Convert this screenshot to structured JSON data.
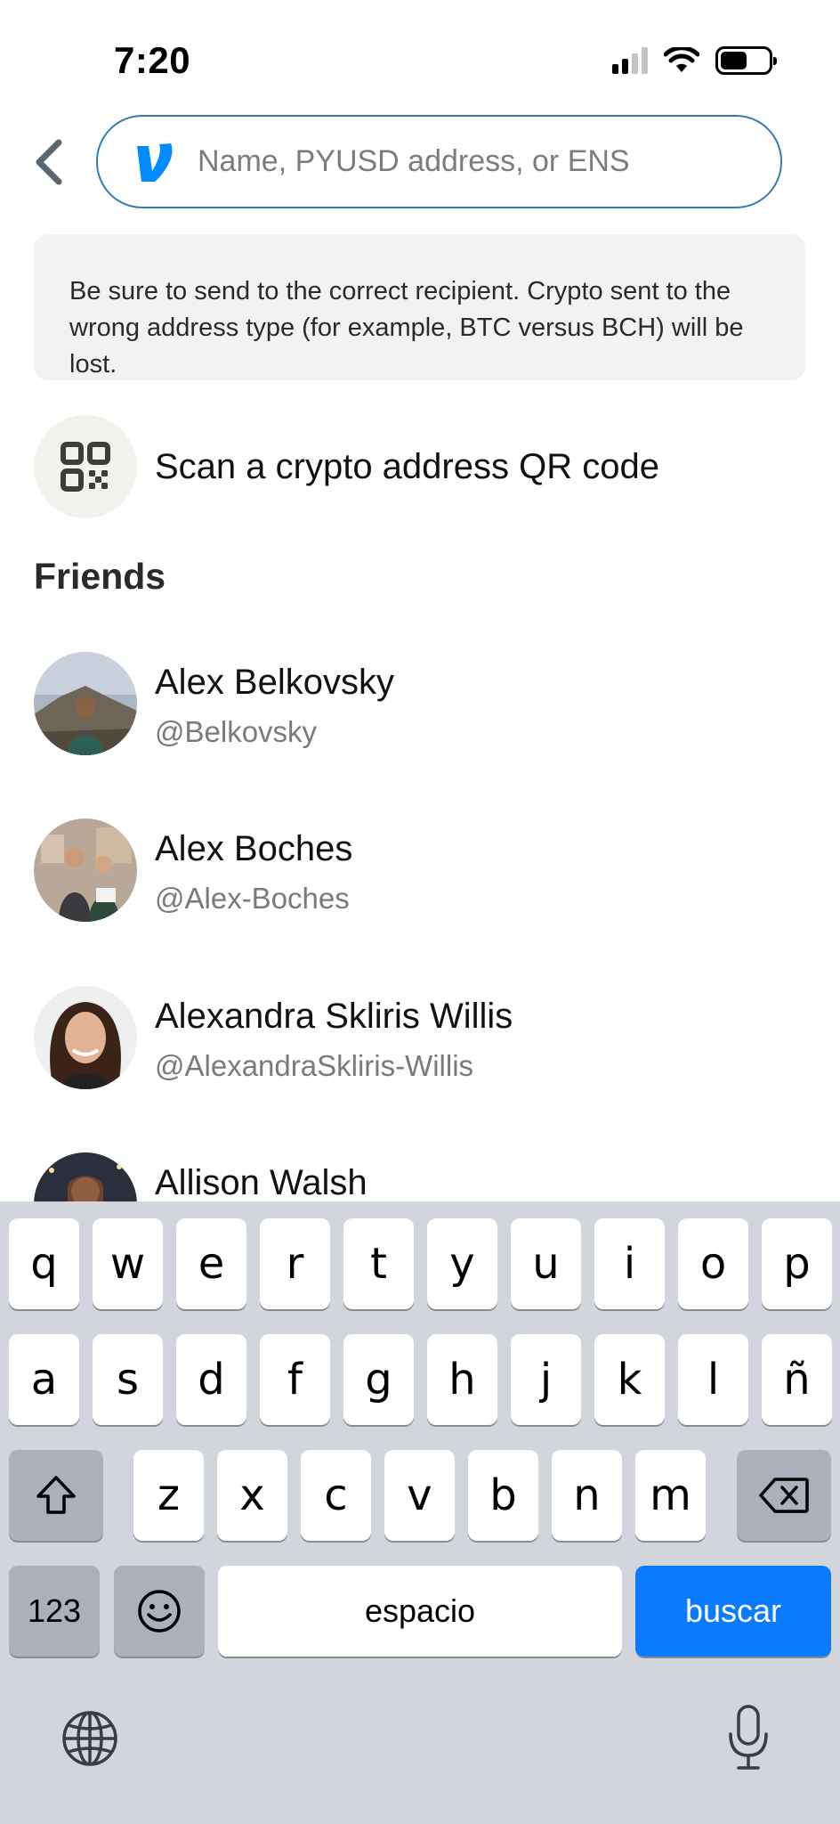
{
  "status_bar": {
    "time": "7:20"
  },
  "header": {
    "search_placeholder": "Name, PYUSD address, or ENS"
  },
  "warning": {
    "text": "Be sure to send to the correct recipient. Crypto sent to the wrong address type (for example, BTC versus BCH) will be lost."
  },
  "scan": {
    "label": "Scan a crypto address QR code"
  },
  "friends": {
    "heading": "Friends",
    "items": [
      {
        "name": "Alex Belkovsky",
        "handle": "@Belkovsky"
      },
      {
        "name": "Alex Boches",
        "handle": "@Alex-Boches"
      },
      {
        "name": "Alexandra Skliris Willis",
        "handle": "@AlexandraSkliris-Willis"
      },
      {
        "name": "Allison Walsh",
        "handle": ""
      }
    ]
  },
  "keyboard": {
    "row1": [
      "q",
      "w",
      "e",
      "r",
      "t",
      "y",
      "u",
      "i",
      "o",
      "p"
    ],
    "row2": [
      "a",
      "s",
      "d",
      "f",
      "g",
      "h",
      "j",
      "k",
      "l",
      "ñ"
    ],
    "row3": [
      "z",
      "x",
      "c",
      "v",
      "b",
      "n",
      "m"
    ],
    "numbers_key": "123",
    "space_key": "espacio",
    "search_key": "buscar"
  },
  "colors": {
    "accent": "#2f7fb5",
    "venmo_blue": "#008cff",
    "search_key": "#0a7bff",
    "keyboard_bg": "#d2d5db"
  }
}
